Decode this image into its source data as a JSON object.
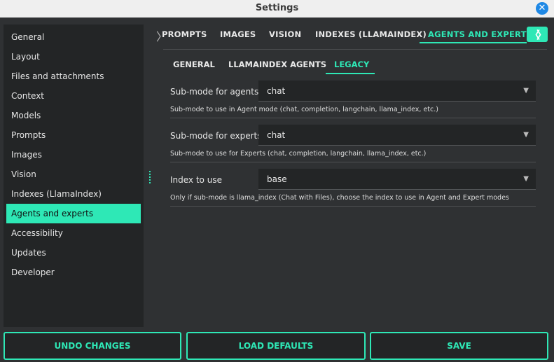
{
  "window": {
    "title": "Settings"
  },
  "sidebar": {
    "items": [
      {
        "label": "General"
      },
      {
        "label": "Layout"
      },
      {
        "label": "Files and attachments"
      },
      {
        "label": "Context"
      },
      {
        "label": "Models"
      },
      {
        "label": "Prompts"
      },
      {
        "label": "Images"
      },
      {
        "label": "Vision"
      },
      {
        "label": "Indexes (LlamaIndex)"
      },
      {
        "label": "Agents and experts"
      },
      {
        "label": "Accessibility"
      },
      {
        "label": "Updates"
      },
      {
        "label": "Developer"
      }
    ],
    "active_index": 9
  },
  "tabs": {
    "items": [
      "PROMPTS",
      "IMAGES",
      "VISION",
      "INDEXES (LLAMAINDEX)",
      "AGENTS AND EXPERTS"
    ],
    "active": "AGENTS AND EXPERTS",
    "scroll_left": "〈",
    "scroll_right": "〉",
    "overflow_left": "〉"
  },
  "subtabs": {
    "items": [
      "GENERAL",
      "LLAMAINDEX AGENTS",
      "LEGACY"
    ],
    "active": "LEGACY"
  },
  "options": [
    {
      "label": "Sub-mode for agents",
      "value": "chat",
      "description": "Sub-mode to use in Agent mode (chat, completion, langchain, llama_index, etc.)"
    },
    {
      "label": "Sub-mode for experts",
      "value": "chat",
      "description": "Sub-mode to use for Experts (chat, completion, langchain, llama_index, etc.)"
    },
    {
      "label": "Index to use",
      "value": "base",
      "description": "Only if sub-mode is llama_index (Chat with Files), choose the index to use in Agent and Expert modes"
    }
  ],
  "footer": {
    "undo_label": "UNDO CHANGES",
    "defaults_label": "LOAD DEFAULTS",
    "save_label": "SAVE"
  },
  "colors": {
    "accent": "#2ee8b6",
    "background": "#2f3133",
    "panel": "#232526"
  }
}
